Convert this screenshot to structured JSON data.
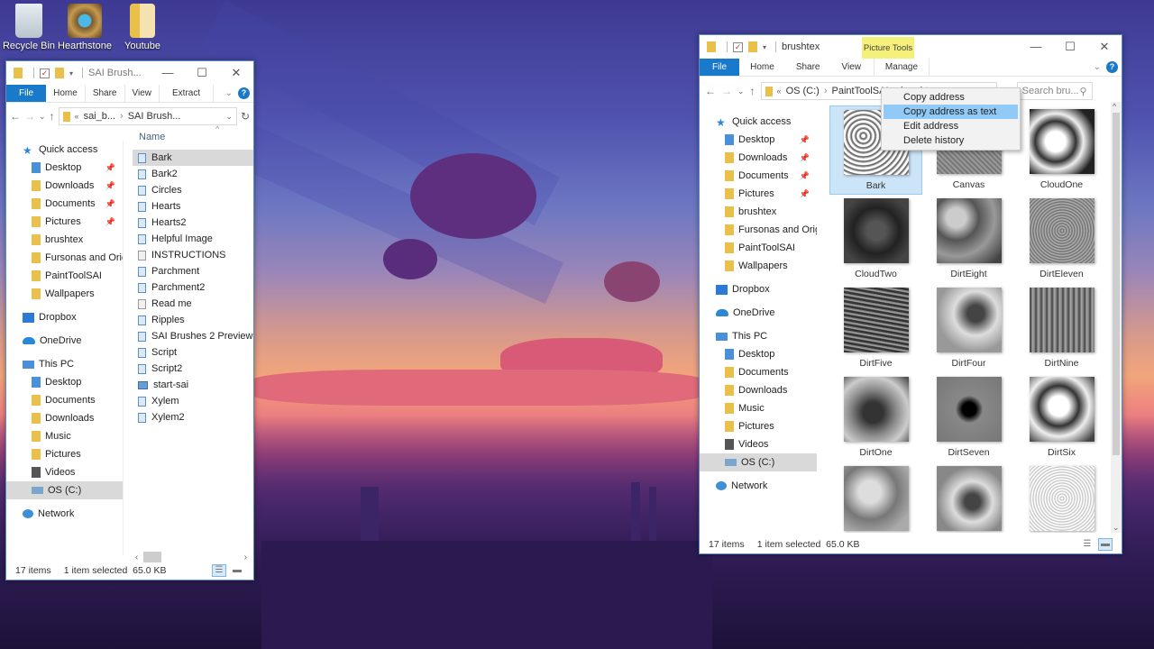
{
  "desktop": {
    "icons": [
      {
        "label": "Recycle Bin",
        "icon": "recycle-bin-icon"
      },
      {
        "label": "Hearthstone",
        "icon": "hearthstone-icon"
      },
      {
        "label": "Youtube",
        "icon": "folder-icon"
      }
    ]
  },
  "left_window": {
    "title": "SAI Brush...",
    "ribbon": {
      "file": "File",
      "tabs": [
        "Home",
        "Share",
        "View",
        "Extract"
      ]
    },
    "address": {
      "prefix": "«",
      "crumbs": [
        "sai_b...",
        "SAI Brush..."
      ]
    },
    "nav": {
      "quick_access": "Quick access",
      "quick_items": [
        "Desktop",
        "Downloads",
        "Documents",
        "Pictures",
        "brushtex",
        "Fursonas and Origin",
        "PaintToolSAI",
        "Wallpapers"
      ],
      "dropbox": "Dropbox",
      "onedrive": "OneDrive",
      "this_pc": "This PC",
      "pc_items": [
        "Desktop",
        "Documents",
        "Downloads",
        "Music",
        "Pictures",
        "Videos",
        "OS (C:)"
      ],
      "network": "Network"
    },
    "column_header": "Name",
    "files": [
      {
        "name": "Bark",
        "type": "image",
        "selected": true
      },
      {
        "name": "Bark2",
        "type": "image"
      },
      {
        "name": "Circles",
        "type": "image"
      },
      {
        "name": "Hearts",
        "type": "image"
      },
      {
        "name": "Hearts2",
        "type": "image"
      },
      {
        "name": "Helpful Image",
        "type": "image"
      },
      {
        "name": "INSTRUCTIONS",
        "type": "text"
      },
      {
        "name": "Parchment",
        "type": "image"
      },
      {
        "name": "Parchment2",
        "type": "image"
      },
      {
        "name": "Read me",
        "type": "text"
      },
      {
        "name": "Ripples",
        "type": "image"
      },
      {
        "name": "SAI Brushes 2 Preview",
        "type": "image"
      },
      {
        "name": "Script",
        "type": "image"
      },
      {
        "name": "Script2",
        "type": "image"
      },
      {
        "name": "start-sai",
        "type": "app"
      },
      {
        "name": "Xylem",
        "type": "image"
      },
      {
        "name": "Xylem2",
        "type": "image"
      }
    ],
    "status": {
      "items": "17 items",
      "selected": "1 item selected",
      "size": "65.0 KB"
    }
  },
  "right_window": {
    "title": "brushtex",
    "context_tab": "Picture Tools",
    "ribbon": {
      "file": "File",
      "tabs": [
        "Home",
        "Share",
        "View",
        "Manage"
      ]
    },
    "address": {
      "prefix": "«",
      "crumbs": [
        "OS (C:)",
        "PaintToolSAI",
        "brushtex"
      ]
    },
    "search_placeholder": "Search bru...",
    "nav": {
      "quick_access": "Quick access",
      "quick_items": [
        "Desktop",
        "Downloads",
        "Documents",
        "Pictures",
        "brushtex",
        "Fursonas and Origin",
        "PaintToolSAI",
        "Wallpapers"
      ],
      "dropbox": "Dropbox",
      "onedrive": "OneDrive",
      "this_pc": "This PC",
      "pc_items": [
        "Desktop",
        "Documents",
        "Downloads",
        "Music",
        "Pictures",
        "Videos",
        "OS (C:)"
      ],
      "network": "Network"
    },
    "thumbnails": [
      "Bark",
      "Canvas",
      "CloudOne",
      "CloudTwo",
      "DirtEight",
      "DirtEleven",
      "DirtFive",
      "DirtFour",
      "DirtNine",
      "DirtOne",
      "DirtSeven",
      "DirtSix",
      "",
      "",
      ""
    ],
    "status": {
      "items": "17 items",
      "selected": "1 item selected",
      "size": "65.0 KB"
    },
    "context_menu": [
      "Copy address",
      "Copy address as text",
      "Edit address",
      "Delete history"
    ]
  },
  "colors": {
    "accent": "#1979ca",
    "picture_tools": "#f4f07a",
    "selection": "#cce4f7",
    "menu_highlight": "#91c9f7"
  }
}
